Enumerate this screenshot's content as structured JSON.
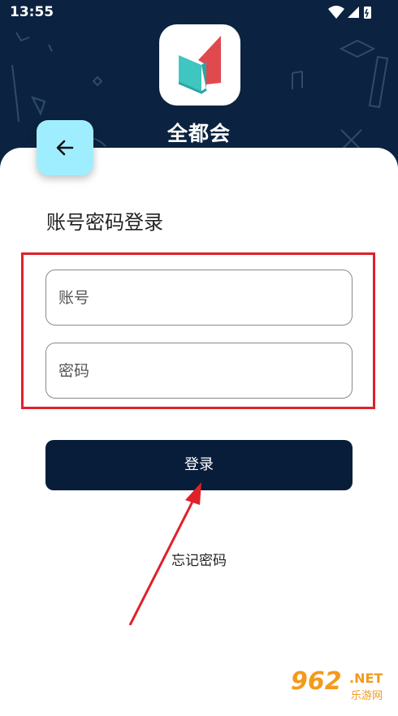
{
  "status_bar": {
    "time": "13:55"
  },
  "app": {
    "name": "全都会"
  },
  "header": {
    "back_icon": "arrow-left-icon"
  },
  "page_title": "账号密码登录",
  "form": {
    "account": {
      "value": "",
      "placeholder": "账号"
    },
    "password": {
      "value": "",
      "placeholder": "密码"
    },
    "login_label": "登录",
    "forgot_label": "忘记密码"
  },
  "watermark": {
    "number": "962",
    "domain": ".NET",
    "site": "乐游网"
  },
  "colors": {
    "header_bg": "#0b2340",
    "back_button_bg": "#9feeff",
    "login_button_bg": "#071d39",
    "annotation_red": "#e0202a",
    "logo_red": "#e04a4f",
    "logo_teal": "#3fc6c0"
  }
}
